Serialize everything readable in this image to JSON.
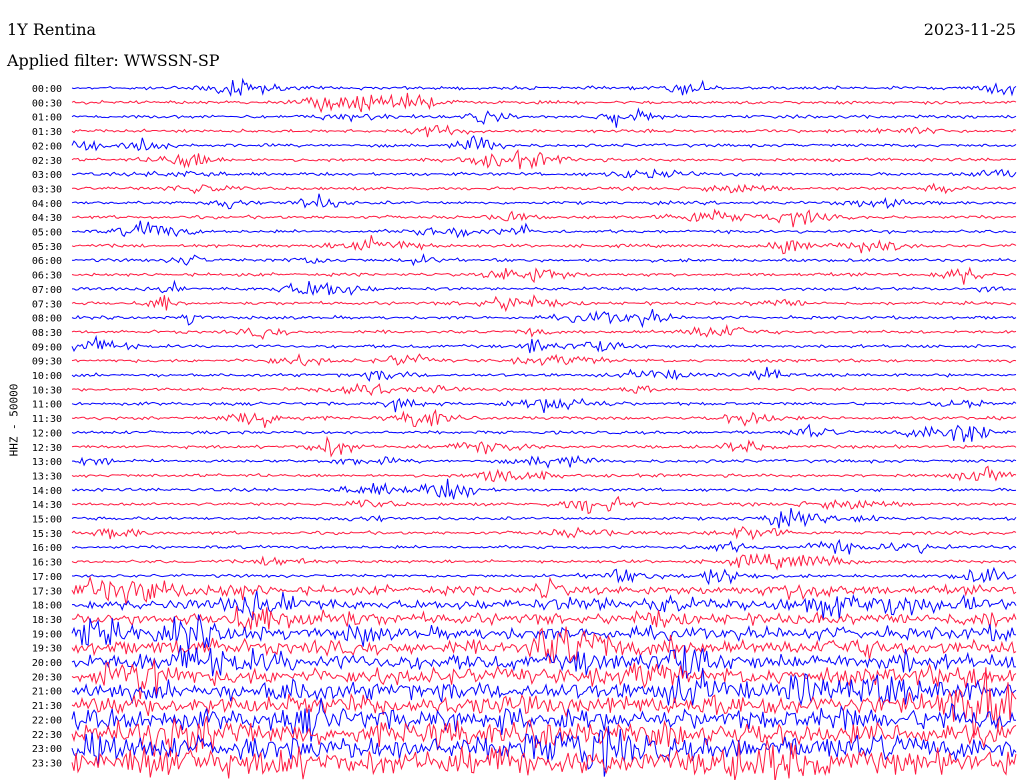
{
  "header": {
    "station": "1Y Rentina",
    "date": "2023-11-25",
    "filter": "Applied filter: WWSSN-SP"
  },
  "axis": {
    "ylabel": "HHZ - 50000"
  },
  "colors": {
    "trace_a": "#0000ff",
    "trace_b": "#ff1a40",
    "background": "#ffffff"
  },
  "chart_data": {
    "type": "line",
    "title": "1Y Rentina",
    "ylabel": "HHZ - 50000",
    "row_labels": [
      "00:00",
      "00:30",
      "01:00",
      "01:30",
      "02:00",
      "02:30",
      "03:00",
      "03:30",
      "04:00",
      "04:30",
      "05:00",
      "05:30",
      "06:00",
      "06:30",
      "07:00",
      "07:30",
      "08:00",
      "08:30",
      "09:00",
      "09:30",
      "10:00",
      "10:30",
      "11:00",
      "11:30",
      "12:00",
      "12:30",
      "13:00",
      "13:30",
      "14:00",
      "14:30",
      "15:00",
      "15:30",
      "16:00",
      "16:30",
      "17:00",
      "17:30",
      "18:00",
      "18:30",
      "19:00",
      "19:30",
      "20:00",
      "20:30",
      "21:00",
      "21:30",
      "22:00",
      "22:30",
      "23:00",
      "23:30"
    ],
    "row_minutes": 30,
    "series_colors": [
      "#0000ff",
      "#ff1a40"
    ],
    "grid": false,
    "legend": "none"
  }
}
